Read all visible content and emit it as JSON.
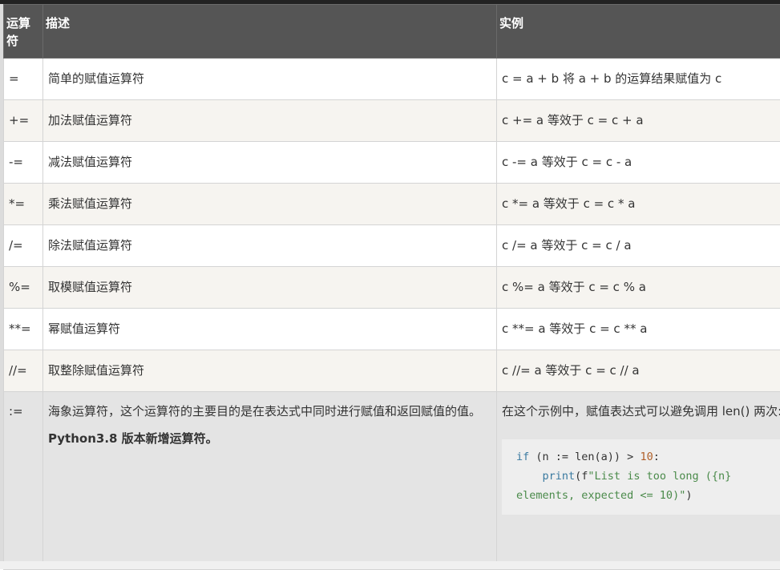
{
  "table": {
    "headers": [
      "运算符",
      "描述",
      "实例"
    ],
    "rows": [
      {
        "op": "=",
        "desc": "简单的赋值运算符",
        "example": "c = a + b 将 a + b 的运算结果赋值为 c"
      },
      {
        "op": "+=",
        "desc": "加法赋值运算符",
        "example": "c += a 等效于 c = c + a"
      },
      {
        "op": "-=",
        "desc": "减法赋值运算符",
        "example": "c -= a 等效于 c = c - a"
      },
      {
        "op": "*=",
        "desc": "乘法赋值运算符",
        "example": "c *= a 等效于 c = c * a"
      },
      {
        "op": "/=",
        "desc": "除法赋值运算符",
        "example": "c /= a 等效于 c = c / a"
      },
      {
        "op": "%=",
        "desc": "取模赋值运算符",
        "example": "c %= a 等效于 c = c % a"
      },
      {
        "op": "**=",
        "desc": "幂赋值运算符",
        "example": "c **= a 等效于 c = c ** a"
      },
      {
        "op": "//=",
        "desc": "取整除赋值运算符",
        "example": "c //= a 等效于 c = c // a"
      }
    ],
    "walrus": {
      "op": ":=",
      "desc_plain": "海象运算符，这个运算符的主要目的是在表达式中同时进行赋值和返回赋值的值。",
      "desc_bold": "Python3.8 版本新增运算符。",
      "example_text": "在这个示例中，赋值表达式可以避免调用 len() 两次:",
      "code": {
        "line1_kw": "if",
        "line1_mid": " (n := len(a)) > ",
        "line1_num": "10",
        "line1_end": ":",
        "line2_fn": "print",
        "line2_open": "(f",
        "line2_str": "\"List is too long ({n} elements, expected <= 10)\"",
        "line2_close": ")"
      }
    }
  }
}
